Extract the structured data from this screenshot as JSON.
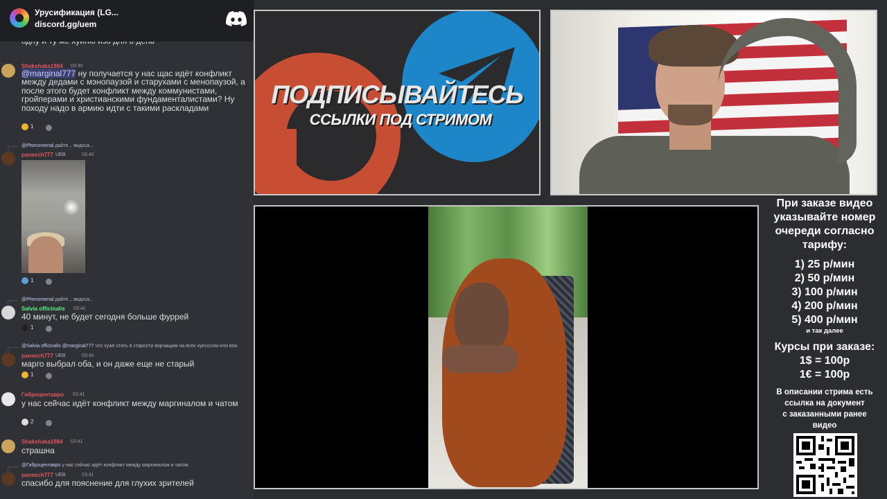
{
  "chat": {
    "server_name": "Урусификация (LG...",
    "server_invite": "discord.gg/uem",
    "fragment_text": "одну и ту же хуйню изо дня в день",
    "messages": [
      {
        "author": "Shakshaka1984",
        "time": "03:40",
        "mention": "@marginal777",
        "text": "ну получается у нас щас идёт конфликт между дедами с мэнопаузой и старухами с менопаузой, а после этого будет конфликт между коммунистами, гройперами и христианскими фундаменталистами? Ну походу надо в армию идти с такими раскладами",
        "reaction_count": "1"
      },
      {
        "reply_author": "@Phenomenal",
        "reply_text": "дайте... видоса...",
        "author": "paneech777",
        "badge": "UEB",
        "time": "03:40",
        "reaction_count": "1"
      },
      {
        "reply_author": "@Phenomenal",
        "reply_text": "дайте... видоса...",
        "author": "Salvia officinalis",
        "time": "03:40",
        "text": "40 минут, не будет сегодня больше фуррей",
        "reaction_count": "1"
      },
      {
        "reply_author": "@Salvia officinalis",
        "reply_mention": "@marginal777",
        "reply_text": "что хуже стать в старости ворчащим на всех хуесосом или впа",
        "author": "paneech777",
        "badge": "UEB",
        "time": "03:40",
        "text": "марго выбрал оба, и он даже еще не старый",
        "reaction_count": "1"
      },
      {
        "author": "Гиброцентавро",
        "time": "03:41",
        "text": "у нас сейчас идёт конфликт между маргиналом и чатом",
        "reaction_count": "2"
      },
      {
        "author": "Shakshaka1984",
        "time": "03:41",
        "text": "страшна"
      },
      {
        "reply_author": "@Гиброцентавро",
        "reply_text": "у нас сейчас идёт конфликт между маргиналом и чатом",
        "author": "paneech777",
        "badge": "UEB",
        "time": "03:41",
        "text": "спасибо для пояснение для глухих зрителей"
      }
    ]
  },
  "promo": {
    "title": "ПОДПИСЫВАЙТЕСЬ",
    "subtitle": "ССЫЛКИ ПОД СТРИМОМ"
  },
  "info": {
    "order_text": [
      "При заказе видео",
      "указывайте номер",
      "очереди согласно",
      "тарифу:"
    ],
    "tariffs": [
      "1) 25 р/мин",
      "2) 50 р/мин",
      "3) 100 р/мин",
      "4) 200 р/мин",
      "5) 400 р/мин"
    ],
    "and_so_on": "и так далее",
    "rates_title": "Курсы при заказе:",
    "rates": [
      "1$ = 100р",
      "1€ = 100р"
    ],
    "description_text": [
      "В описании стрима есть",
      "ссылка на документ",
      "с заказанными ранее",
      "видео"
    ]
  },
  "colors": {
    "chat_bg": "#2f3136",
    "header_bg": "#1e1f22",
    "name_red": "#e0565b",
    "name_green": "#57f287",
    "name_yellow": "#f0b232",
    "mention": "#c9cdfb",
    "telegram_blue": "#1c86c9",
    "patreon_orange": "#c74e33"
  },
  "icons": {
    "discord": "discord-logo-icon",
    "telegram": "telegram-plane-icon",
    "patreon": "patreon-p-icon",
    "qr": "qr-code-icon"
  }
}
